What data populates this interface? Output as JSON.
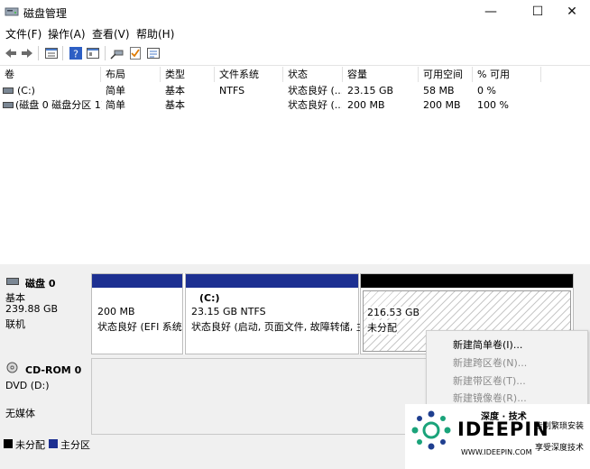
{
  "window": {
    "title": "磁盘管理",
    "minimize": "—",
    "maximize": "☐",
    "close": "✕"
  },
  "menu": [
    "文件(F)",
    "操作(A)",
    "查看(V)",
    "帮助(H)"
  ],
  "toolbar": [
    "back-arrow-icon",
    "forward-arrow-icon",
    "list-view-icon",
    "help-icon",
    "properties-icon",
    "connect-icon",
    "check-icon",
    "settings-icon"
  ],
  "volume_list": {
    "columns": [
      "卷",
      "布局",
      "类型",
      "文件系统",
      "状态",
      "容量",
      "可用空间",
      "% 可用"
    ],
    "rows": [
      [
        "(C:)",
        "简单",
        "基本",
        "NTFS",
        "状态良好 (...",
        "23.15 GB",
        "58 MB",
        "0 %"
      ],
      [
        "(磁盘 0 磁盘分区 1)",
        "简单",
        "基本",
        "",
        "状态良好 (...",
        "200 MB",
        "200 MB",
        "100 %"
      ]
    ]
  },
  "disk0": {
    "name": "磁盘 0",
    "type": "基本",
    "size": "239.88 GB",
    "status": "联机",
    "partitions": [
      {
        "size": "200 MB",
        "status": "状态良好 (EFI 系统",
        "bar_color": "#1c2f91"
      },
      {
        "label": "(C:)",
        "size": "23.15 GB NTFS",
        "status": "状态良好 (启动, 页面文件, 故障转储, 主",
        "bar_color": "#1c2f91"
      },
      {
        "size": "216.53 GB",
        "status": "未分配",
        "bar_color": "#000000"
      }
    ]
  },
  "cdrom0": {
    "name": "CD-ROM 0",
    "drive": "DVD (D:)",
    "status": "无媒体"
  },
  "context_menu": [
    {
      "label": "新建简单卷(I)...",
      "enabled": true
    },
    {
      "label": "新建跨区卷(N)...",
      "enabled": false
    },
    {
      "label": "新建带区卷(T)...",
      "enabled": false
    },
    {
      "label": "新建镜像卷(R)...",
      "enabled": false
    }
  ],
  "legend": [
    {
      "label": "未分配",
      "color": "#000000"
    },
    {
      "label": "主分区",
      "color": "#1c2f91"
    }
  ],
  "watermark": {
    "top": "深度 · 技术",
    "logo": "IDEEPIN",
    "url": "WWW.IDEEPIN.COM",
    "slogan1": "告别繁琐安装",
    "slogan2": "享受深度技术"
  }
}
